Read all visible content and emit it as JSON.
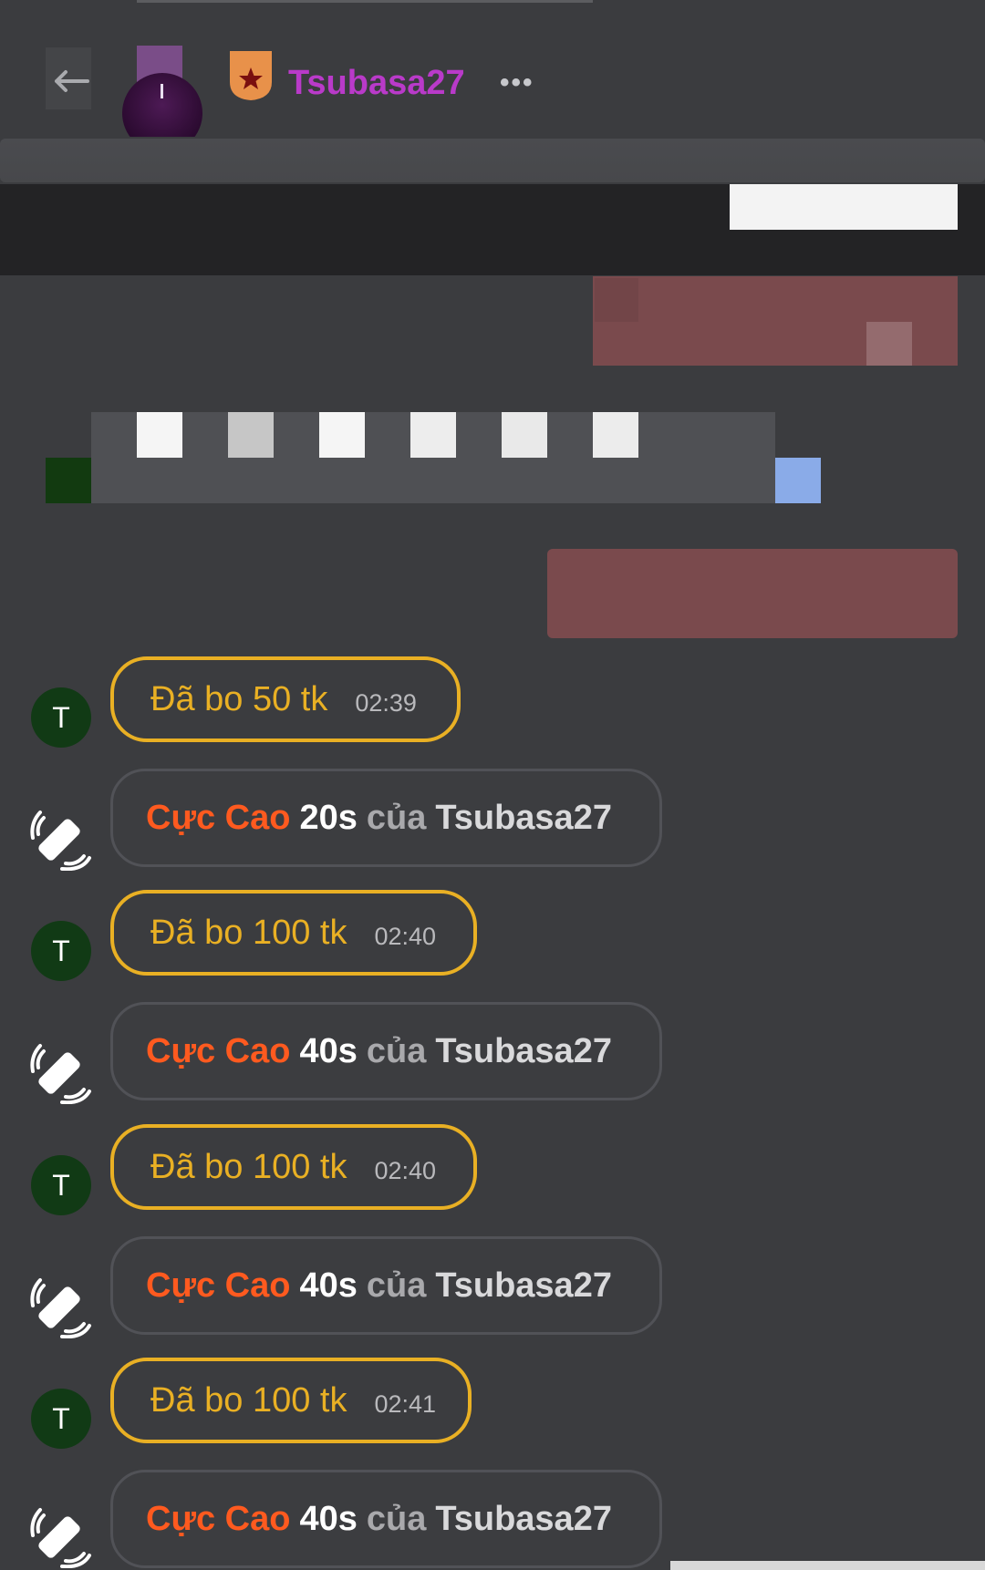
{
  "header": {
    "username": "Tsubasa27",
    "more_label": "•••",
    "colors": {
      "username": "#b93ac9",
      "badge": "#e8914a"
    }
  },
  "messages": [
    {
      "type": "tip",
      "avatar": "T",
      "text": "Đã bo 50 tk",
      "time": "02:39"
    },
    {
      "type": "gift",
      "gift_name": "Cực Cao",
      "duration": "20s",
      "connector": "của",
      "user": "Tsubasa27"
    },
    {
      "type": "tip",
      "avatar": "T",
      "text": "Đã bo 100 tk",
      "time": "02:40"
    },
    {
      "type": "gift",
      "gift_name": "Cực Cao",
      "duration": "40s",
      "connector": "của",
      "user": "Tsubasa27"
    },
    {
      "type": "tip",
      "avatar": "T",
      "text": "Đã bo 100 tk",
      "time": "02:40"
    },
    {
      "type": "gift",
      "gift_name": "Cực Cao",
      "duration": "40s",
      "connector": "của",
      "user": "Tsubasa27"
    },
    {
      "type": "tip",
      "avatar": "T",
      "text": "Đã bo 100 tk",
      "time": "02:41"
    },
    {
      "type": "gift",
      "gift_name": "Cực Cao",
      "duration": "40s",
      "connector": "của",
      "user": "Tsubasa27"
    }
  ],
  "icons": {
    "back": "back-arrow-icon",
    "badge": "star-badge-icon",
    "gift": "vibration-gift-icon"
  },
  "colors": {
    "tip_border": "#e9b024",
    "gift_name": "#ff5a1f",
    "avatar_bg": "#113a15"
  }
}
